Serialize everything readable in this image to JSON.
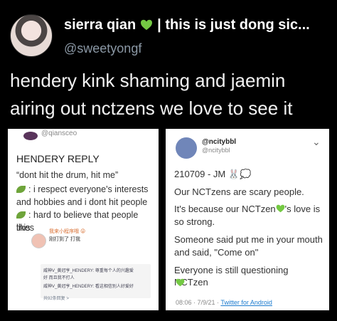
{
  "tweet": {
    "author_name": "sierra qian",
    "author_suffix": "| this is just dong sic...",
    "handle": "@sweetyongf",
    "text_line1": "hendery kink shaming and jaemin",
    "text_line2": "airing out nctzens we love to see it"
  },
  "left_card": {
    "handle": "@qiansceo",
    "title": "HENDERY REPLY",
    "quote": "“dont hit the drum, hit me”",
    "line1": ": i respect everyone's interests",
    "line2": "and hobbies and i dont hit people",
    "line3": ": hard to believe that people likes",
    "line4": "this",
    "weibo_name": "我来小程序哦 😜",
    "weibo_reply": "刚打到了 打我",
    "reply1": "威神V_黄冠亨_HENDERY: 尊重每个人的兴趣爱",
    "reply1b": "好 而且我不打人",
    "reply2": "威神V_黄冠亨_HENDERY: 看这相信别人好爱好",
    "more": "共92条回复 >"
  },
  "right_card": {
    "name": "@ncitybbl",
    "handle": "@ncitybbl",
    "line1": "210709 - JM 🐰💭",
    "line2": "Our NCTzens are scary people.",
    "line3a": "It's because our NCTzen",
    "line3b": "'s love is",
    "line4": "so strong.",
    "line5": "Someone said put me in your mouth",
    "line6": "and said, \"Come on\"",
    "line7": "Everyone is still questioning NCTzen",
    "date": "08:06 · 7/9/21 · ",
    "source": "Twitter for Android"
  }
}
